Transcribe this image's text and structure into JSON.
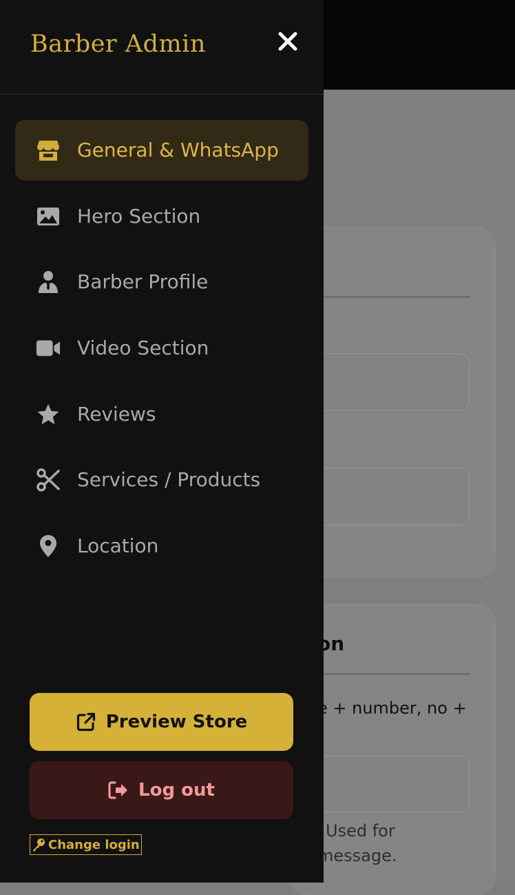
{
  "drawer": {
    "brand": "Barber Admin",
    "close_icon": "close-icon",
    "nav": [
      {
        "label": "General & WhatsApp",
        "icon": "store-icon",
        "active": true
      },
      {
        "label": "Hero Section",
        "icon": "image-icon",
        "active": false
      },
      {
        "label": "Barber Profile",
        "icon": "user-tie-icon",
        "active": false
      },
      {
        "label": "Video Section",
        "icon": "video-icon",
        "active": false
      },
      {
        "label": "Reviews",
        "icon": "star-icon",
        "active": false
      },
      {
        "label": "Services / Products",
        "icon": "scissors-icon",
        "active": false
      },
      {
        "label": "Location",
        "icon": "map-pin-icon",
        "active": false
      }
    ],
    "preview_button": "Preview Store",
    "logout_button": "Log out",
    "change_login": "Change login"
  },
  "background": {
    "card2_heading_fragment": "on",
    "card2_text_fragment": "e + number, no +",
    "card2_help_line1": "Used for",
    "card2_help_line2": "message."
  },
  "colors": {
    "accent": "#d4ad3d",
    "drawer_bg": "#111111",
    "active_bg": "#322a16",
    "logout_bg": "#3b1818",
    "logout_text": "#f19a9a"
  }
}
